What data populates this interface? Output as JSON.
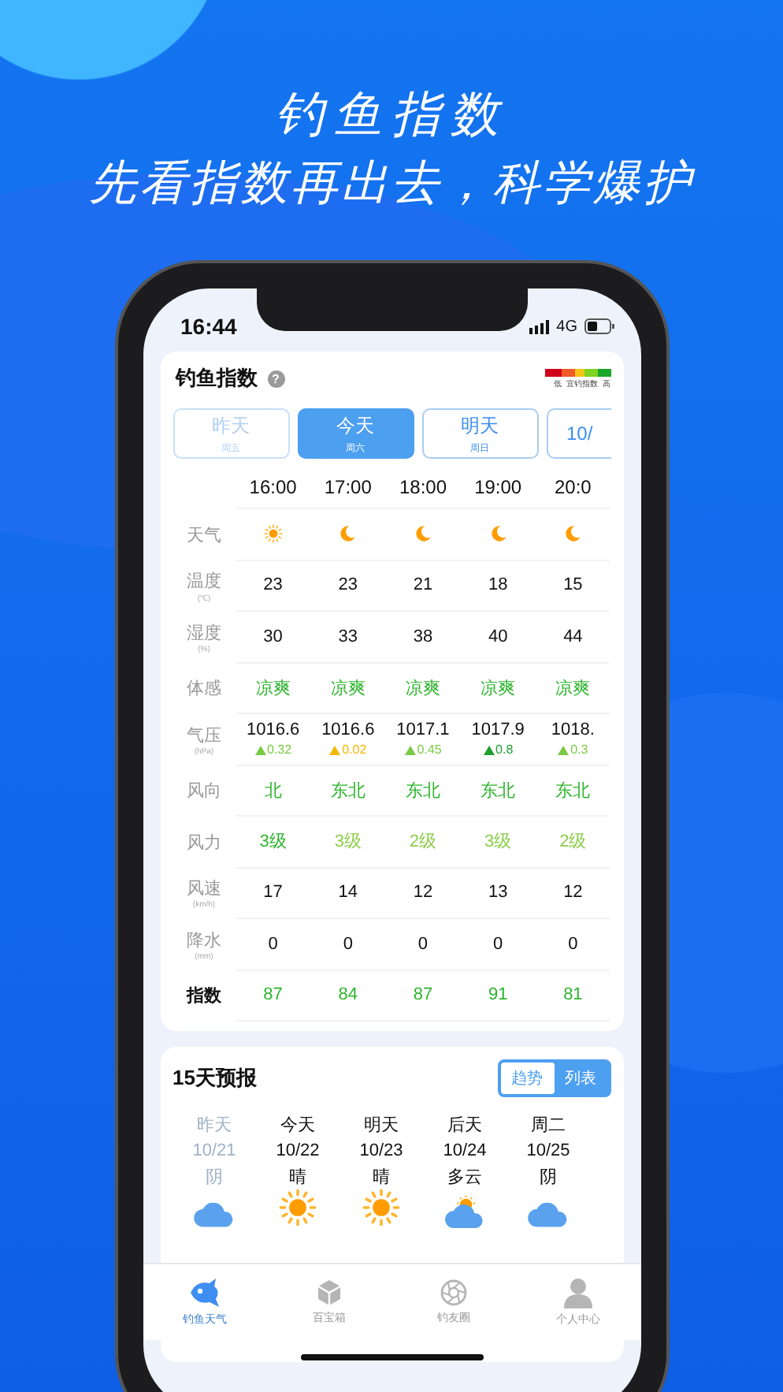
{
  "headline": {
    "title": "钓鱼指数",
    "subtitle": "先看指数再出去，科学爆护"
  },
  "status_bar": {
    "time": "16:44",
    "network": "4G"
  },
  "index_card": {
    "title": "钓鱼指数",
    "help": "?",
    "legend": {
      "low": "低",
      "middle": "宜钓指数",
      "high": "高"
    },
    "days": [
      {
        "label": "昨天",
        "weekday": "周五",
        "selected": false,
        "past": true
      },
      {
        "label": "今天",
        "weekday": "周六",
        "selected": true,
        "past": false
      },
      {
        "label": "明天",
        "weekday": "周日",
        "selected": false,
        "past": false
      },
      {
        "label": "10/",
        "selected": false,
        "past": false
      }
    ],
    "hours": [
      "16:00",
      "17:00",
      "18:00",
      "19:00",
      "20:0"
    ],
    "rows": [
      {
        "kind": "weather",
        "label": "天气",
        "cells": [
          {
            "kind": "sun"
          },
          {
            "kind": "moon"
          },
          {
            "kind": "moon"
          },
          {
            "kind": "moon"
          },
          {
            "kind": "moon"
          }
        ]
      },
      {
        "kind": "plain",
        "label": "温度",
        "unit": "(℃)",
        "cells": [
          {
            "value": "23"
          },
          {
            "value": "23"
          },
          {
            "value": "21"
          },
          {
            "value": "18"
          },
          {
            "value": "15"
          }
        ]
      },
      {
        "kind": "plain",
        "label": "湿度",
        "unit": "(%)",
        "cells": [
          {
            "value": "30"
          },
          {
            "value": "33"
          },
          {
            "value": "38"
          },
          {
            "value": "40"
          },
          {
            "value": "44"
          }
        ]
      },
      {
        "kind": "green",
        "label": "体感",
        "cells": [
          {
            "value": "凉爽"
          },
          {
            "value": "凉爽"
          },
          {
            "value": "凉爽"
          },
          {
            "value": "凉爽"
          },
          {
            "value": "凉爽"
          }
        ]
      },
      {
        "kind": "pressure",
        "label": "气压",
        "unit": "(hPa)",
        "cells": [
          {
            "value": "1016.6",
            "change": "0.32",
            "color": "#7ac943"
          },
          {
            "value": "1016.6",
            "change": "0.02",
            "color": "#f5b800"
          },
          {
            "value": "1017.1",
            "change": "0.45",
            "color": "#7ac943"
          },
          {
            "value": "1017.9",
            "change": "0.8",
            "color": "#1f9e2e"
          },
          {
            "value": "1018.",
            "change": "0.3",
            "color": "#7ac943"
          }
        ]
      },
      {
        "kind": "green",
        "label": "风向",
        "cells": [
          {
            "value": "北"
          },
          {
            "value": "东北"
          },
          {
            "value": "东北"
          },
          {
            "value": "东北"
          },
          {
            "value": "东北"
          }
        ]
      },
      {
        "kind": "colored",
        "label": "风力",
        "cells": [
          {
            "value": "3级",
            "color": "#2db52d"
          },
          {
            "value": "3级",
            "color": "#8ccd4a"
          },
          {
            "value": "2级",
            "color": "#8ccd4a"
          },
          {
            "value": "3级",
            "color": "#8ccd4a"
          },
          {
            "value": "2级",
            "color": "#8ccd4a"
          }
        ]
      },
      {
        "kind": "plain",
        "label": "风速",
        "unit": "(km/h)",
        "cells": [
          {
            "value": "17"
          },
          {
            "value": "14"
          },
          {
            "value": "12"
          },
          {
            "value": "13"
          },
          {
            "value": "12"
          }
        ]
      },
      {
        "kind": "plain",
        "label": "降水",
        "unit": "(mm)",
        "cells": [
          {
            "value": "0"
          },
          {
            "value": "0"
          },
          {
            "value": "0"
          },
          {
            "value": "0"
          },
          {
            "value": "0"
          }
        ]
      },
      {
        "kind": "index",
        "label": "指数",
        "cells": [
          {
            "value": "87"
          },
          {
            "value": "84"
          },
          {
            "value": "87"
          },
          {
            "value": "91"
          },
          {
            "value": "81"
          }
        ]
      }
    ]
  },
  "forecast_card": {
    "title": "15天预报",
    "toggle": [
      {
        "label": "趋势",
        "selected": true
      },
      {
        "label": "列表",
        "selected": false
      }
    ],
    "days": [
      {
        "label": "昨天",
        "date": "10/21",
        "weather": "阴",
        "kind": "cloud",
        "past": true
      },
      {
        "label": "今天",
        "date": "10/22",
        "weather": "晴",
        "kind": "sun",
        "past": false
      },
      {
        "label": "明天",
        "date": "10/23",
        "weather": "晴",
        "kind": "sun",
        "past": false
      },
      {
        "label": "后天",
        "date": "10/24",
        "weather": "多云",
        "kind": "partly",
        "past": false
      },
      {
        "label": "周二",
        "date": "10/25",
        "weather": "阴",
        "kind": "cloud",
        "past": false
      }
    ]
  },
  "tab_bar": [
    {
      "label": "钓鱼天气",
      "kind": "fish",
      "selected": true
    },
    {
      "label": "百宝箱",
      "kind": "cube",
      "selected": false
    },
    {
      "label": "钓友圈",
      "kind": "aperture",
      "selected": false
    },
    {
      "label": "个人中心",
      "kind": "person",
      "selected": false
    }
  ]
}
